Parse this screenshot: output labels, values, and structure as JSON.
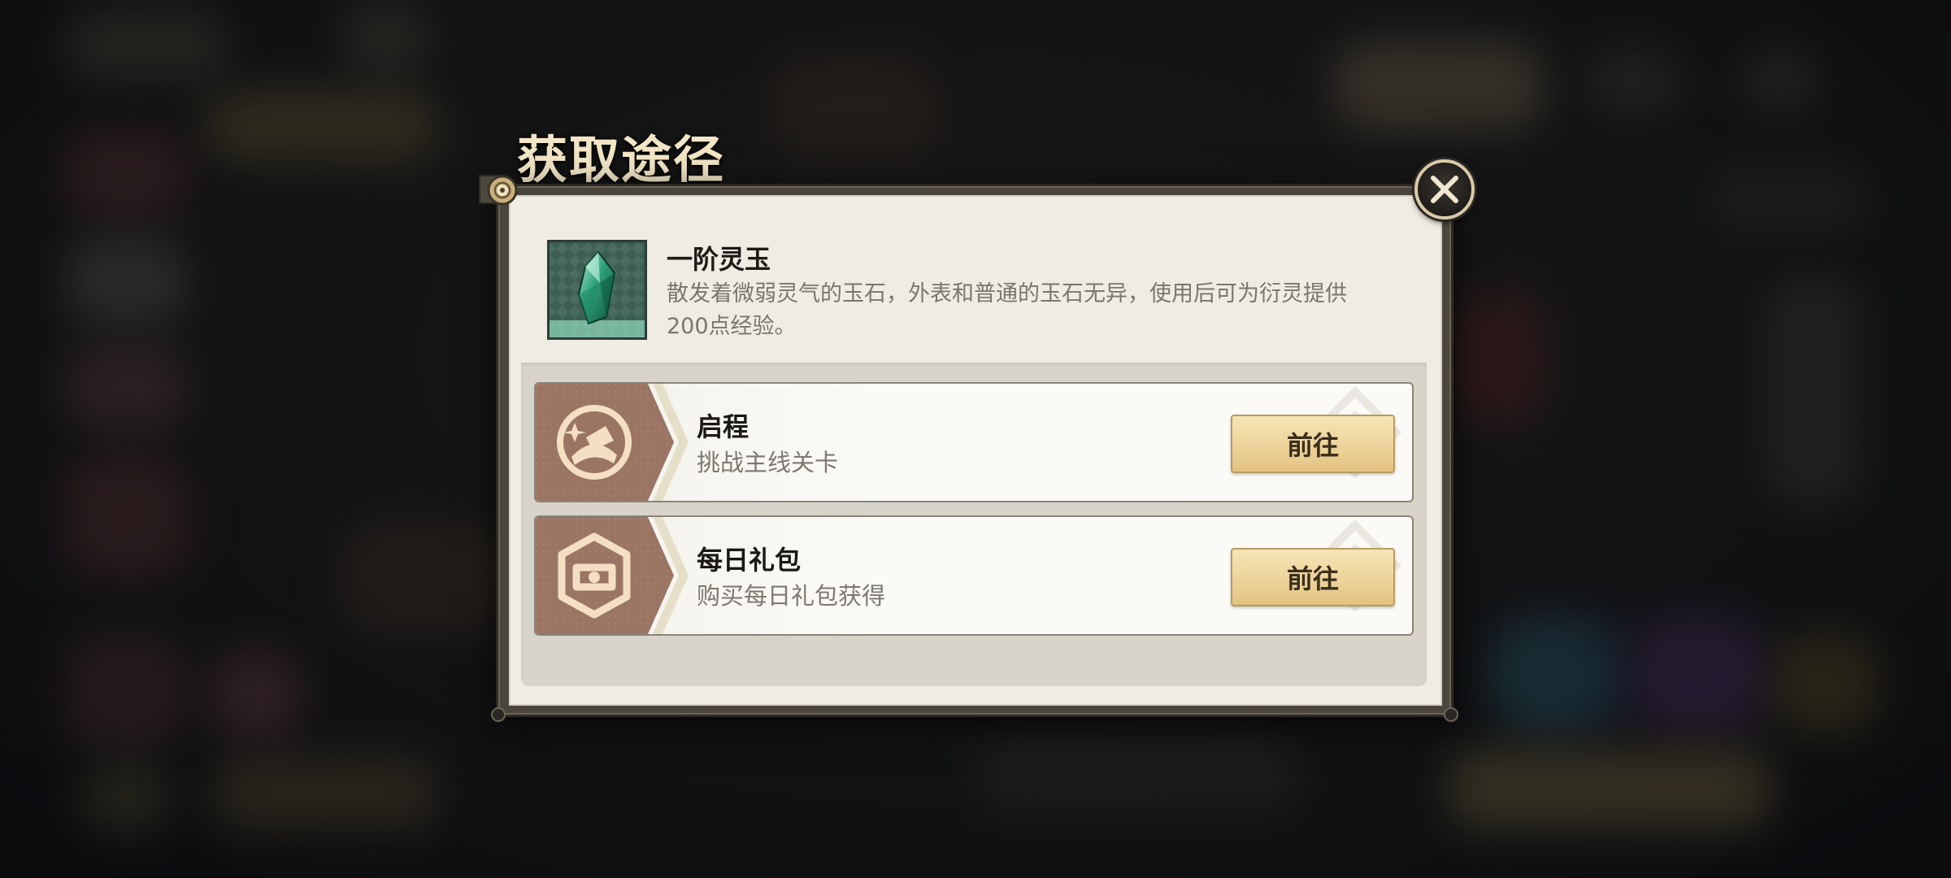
{
  "dialog": {
    "title": "获取途径",
    "close_icon": "close-icon"
  },
  "item": {
    "name": "一阶灵玉",
    "description_line1": "散发着微弱灵气的玉石，外表和普通的玉石无异，使用后可为衍灵提供",
    "description_line2": "200点经验。",
    "icon": "jade-crystal-icon"
  },
  "sources": [
    {
      "title": "启程",
      "subtitle": "挑战主线关卡",
      "button_label": "前往",
      "icon": "journey-compass-icon"
    },
    {
      "title": "每日礼包",
      "subtitle": "购买每日礼包获得",
      "button_label": "前往",
      "icon": "gift-package-icon"
    }
  ],
  "colors": {
    "panel": "#efece3",
    "button_gold": "#edd39a",
    "hex_brown": "#9a7563",
    "title_gold": "#f3e6c6"
  }
}
